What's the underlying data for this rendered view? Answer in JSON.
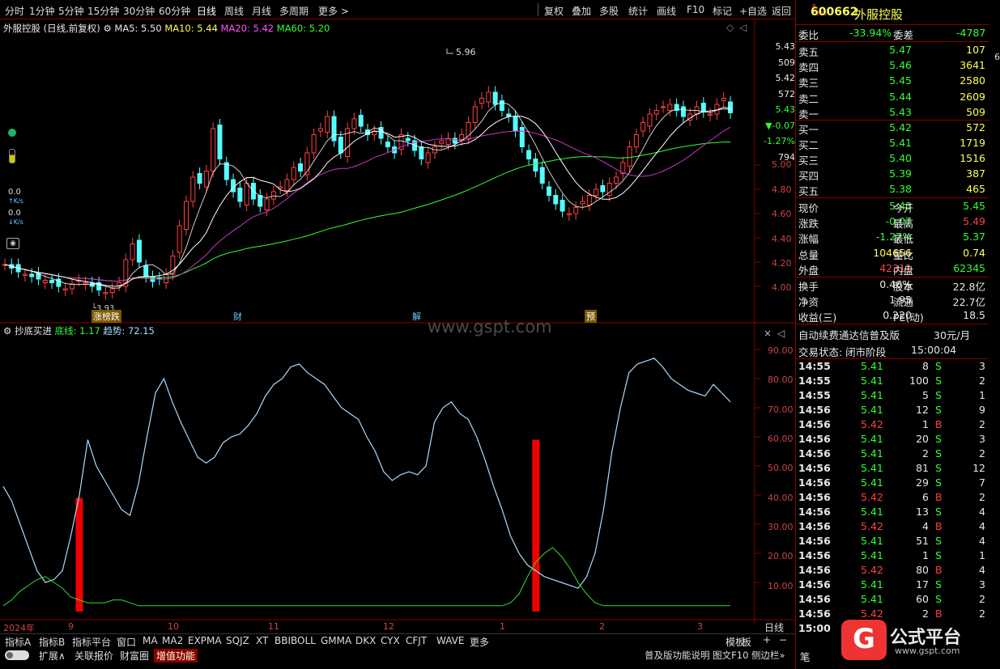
{
  "toolbar": {
    "periods": [
      "分时",
      "1分钟",
      "5分钟",
      "15分钟",
      "30分钟",
      "60分钟",
      "日线",
      "周线",
      "月线",
      "多周期",
      "更多 >"
    ],
    "actions": [
      "复权",
      "叠加",
      "多股",
      "统计",
      "画线",
      "F10",
      "标记",
      "+自选",
      "返回"
    ]
  },
  "main_legend": {
    "name": "外服控股",
    "mode": "(日线,前复权)",
    "ma5": "MA5: 5.50",
    "ma10": "MA10: 5.44",
    "ma20": "MA20: 5.42",
    "ma60": "MA60: 5.20"
  },
  "sub_legend": {
    "name": "抄底买进",
    "bottom": "底线: 1.17",
    "trend": "趋势: 72.15"
  },
  "left_tools": {
    "speed1": "0.0",
    "speed1_unit": "K/s",
    "speed2": "0.0",
    "speed2_unit": "K/s"
  },
  "watermark": "www.gspt.com",
  "markers": {
    "low_label": "3.93",
    "high_label": "5.96",
    "tag1": "涨榜跌",
    "tag2": "财",
    "tag3": "解",
    "tag4": "预"
  },
  "price_axis": {
    "top_values": [
      "5.43",
      "509",
      "5.42",
      "572",
      "5.43",
      "▼-0.07",
      "-1.27%",
      "794"
    ],
    "ticks": [
      "5.00",
      "4.80",
      "4.60",
      "4.40",
      "4.20",
      "4.00"
    ]
  },
  "sub_axis": {
    "ticks": [
      "90.00",
      "80.00",
      "70.00",
      "60.00",
      "50.00",
      "40.00",
      "30.00",
      "20.00",
      "10.00"
    ]
  },
  "x_axis": {
    "labels": [
      "2024年",
      "9",
      "10",
      "11",
      "12",
      "1",
      "2",
      "3"
    ],
    "period": "日线"
  },
  "chart_data": {
    "type": "line",
    "title": "外服控股 (日线,前复权)",
    "price_range": [
      3.85,
      6.1
    ],
    "ma_values": {
      "MA5": 5.5,
      "MA10": 5.44,
      "MA20": 5.42,
      "MA60": 5.2
    },
    "high": 5.96,
    "low": 3.93,
    "indicator": {
      "name": "抄底买进",
      "ylim": [
        0,
        95
      ],
      "trend": [
        43,
        38,
        30,
        22,
        14,
        10,
        11,
        14,
        26,
        40,
        59,
        50,
        45,
        40,
        35,
        33,
        44,
        60,
        75,
        80,
        72,
        65,
        59,
        53,
        51,
        53,
        58,
        60,
        61,
        64,
        68,
        74,
        78,
        80,
        84,
        85,
        82,
        80,
        78,
        74,
        70,
        68,
        66,
        60,
        55,
        48,
        45,
        47,
        48,
        47,
        50,
        65,
        70,
        72,
        68,
        66,
        60,
        52,
        43,
        35,
        26,
        20,
        16,
        14,
        12,
        11,
        10,
        9,
        8,
        12,
        20,
        35,
        55,
        70,
        82,
        85,
        86,
        87,
        84,
        80,
        78,
        76,
        75,
        74,
        78,
        75,
        72
      ],
      "bottom": [
        2,
        4,
        7,
        9,
        11,
        12,
        10,
        8,
        5,
        4,
        3,
        3,
        3,
        4,
        4,
        3,
        2,
        2,
        2,
        2,
        2,
        2,
        2,
        2,
        2,
        2,
        2,
        2,
        2,
        2,
        2,
        2,
        2,
        2,
        2,
        2,
        2,
        2,
        2,
        2,
        2,
        2,
        2,
        2,
        2,
        2,
        2,
        2,
        2,
        2,
        2,
        2,
        2,
        2,
        2,
        2,
        2,
        2,
        2,
        2,
        3,
        6,
        12,
        17,
        20,
        22,
        19,
        15,
        10,
        6,
        3,
        2,
        2,
        2,
        2,
        2,
        2,
        2,
        2,
        2,
        2,
        2,
        2,
        2,
        2,
        2,
        2
      ],
      "signals": [
        {
          "index": 9,
          "value": 39
        },
        {
          "index": 63,
          "value": 59
        }
      ]
    }
  },
  "quote": {
    "code": "600662",
    "name": "外服控股",
    "wb_label": "委比",
    "wb": "-33.94%",
    "wc_label": "委差",
    "wc": "-4787",
    "asks": [
      [
        "卖五",
        "5.47",
        "107"
      ],
      [
        "卖四",
        "5.46",
        "3641"
      ],
      [
        "卖三",
        "5.45",
        "2580"
      ],
      [
        "卖二",
        "5.44",
        "2609"
      ],
      [
        "卖一",
        "5.43",
        "509"
      ]
    ],
    "bids": [
      [
        "买一",
        "5.42",
        "572"
      ],
      [
        "买二",
        "5.41",
        "1719"
      ],
      [
        "买三",
        "5.40",
        "1516"
      ],
      [
        "买四",
        "5.39",
        "387"
      ],
      [
        "买五",
        "5.38",
        "465"
      ]
    ],
    "stats": [
      [
        "现价",
        "5.43",
        "今开",
        "5.45"
      ],
      [
        "涨跌",
        "-0.07",
        "最高",
        "5.49"
      ],
      [
        "涨幅",
        "-1.27%",
        "最低",
        "5.37"
      ],
      [
        "总量",
        "104656",
        "量比",
        "0.74"
      ],
      [
        "外盘",
        "42311",
        "内盘",
        "62345"
      ]
    ],
    "stats2": [
      [
        "换手",
        "0.46%",
        "股本",
        "22.8亿"
      ],
      [
        "净资",
        "1.95",
        "流通",
        "22.7亿"
      ],
      [
        "收益(三)",
        "0.220",
        "PE(动)",
        "18.5"
      ]
    ],
    "promo": "自动续费通达信普及版",
    "promo_price": "30元/月",
    "status_label": "交易状态: 闭市阶段",
    "status_time": "15:00:04",
    "ticks": [
      [
        "14:55",
        "5.41",
        "8",
        "S",
        "3"
      ],
      [
        "14:55",
        "5.41",
        "100",
        "S",
        "2"
      ],
      [
        "14:55",
        "5.41",
        "5",
        "S",
        "1"
      ],
      [
        "14:56",
        "5.41",
        "12",
        "S",
        "9"
      ],
      [
        "14:56",
        "5.42",
        "1",
        "B",
        "2"
      ],
      [
        "14:56",
        "5.41",
        "20",
        "S",
        "3"
      ],
      [
        "14:56",
        "5.41",
        "2",
        "S",
        "2"
      ],
      [
        "14:56",
        "5.41",
        "81",
        "S",
        "12"
      ],
      [
        "14:56",
        "5.41",
        "29",
        "S",
        "7"
      ],
      [
        "14:56",
        "5.42",
        "6",
        "B",
        "2"
      ],
      [
        "14:56",
        "5.41",
        "13",
        "S",
        "4"
      ],
      [
        "14:56",
        "5.42",
        "4",
        "B",
        "4"
      ],
      [
        "14:56",
        "5.41",
        "51",
        "S",
        "4"
      ],
      [
        "14:56",
        "5.41",
        "1",
        "S",
        "1"
      ],
      [
        "14:56",
        "5.42",
        "80",
        "B",
        "4"
      ],
      [
        "14:56",
        "5.41",
        "17",
        "S",
        "3"
      ],
      [
        "14:56",
        "5.41",
        "60",
        "S",
        "2"
      ],
      [
        "14:56",
        "5.42",
        "2",
        "B",
        "2"
      ],
      [
        "15:00",
        "",
        "",
        "",
        ""
      ]
    ]
  },
  "bottom": {
    "tabs": [
      "指标A",
      "指标B",
      "指标平台",
      "窗口",
      "MA",
      "MA2",
      "EXPMA",
      "SQJZ",
      "XT",
      "BBIBOLL",
      "GMMA",
      "DKX",
      "CYX",
      "CFJT",
      "WAVE",
      "更多"
    ],
    "tabs2": [
      "扩展∧",
      "关联报价",
      "财富圈",
      "增值功能"
    ],
    "template": "模板",
    "board": "板",
    "right_note": "普及版功能说明 图文F10 侧边栏»",
    "brand": "公式平台",
    "brand_url": "www.gspt.com"
  },
  "colors": {
    "up": "#ff4040",
    "down": "#54ffff",
    "ma5": "#ffffff",
    "ma10": "#ffff55",
    "ma20": "#ff40ff",
    "ma60": "#33ff33",
    "border": "#8a0000"
  }
}
